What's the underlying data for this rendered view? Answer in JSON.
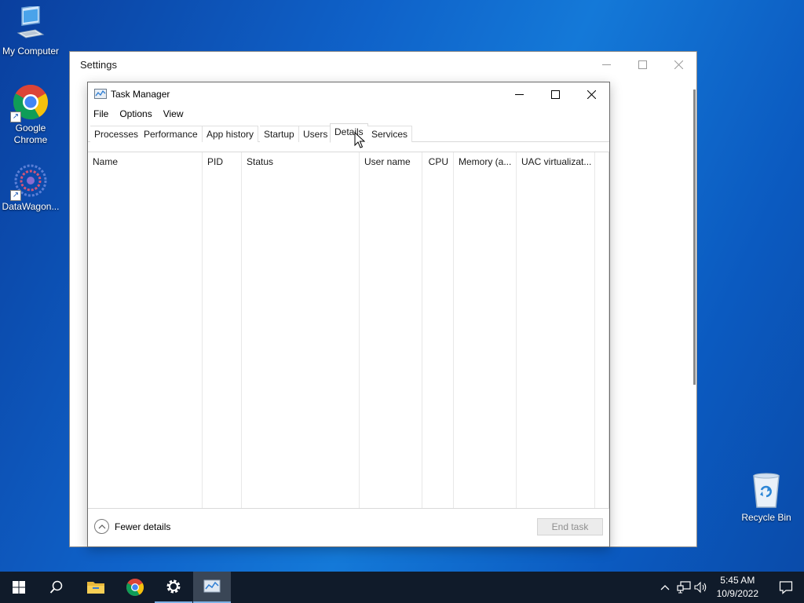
{
  "desktop": {
    "icons": [
      {
        "label": "My Computer",
        "icon": "computer-icon"
      },
      {
        "label": "Google Chrome",
        "icon": "chrome-icon"
      },
      {
        "label": "DataWagon...",
        "icon": "datawagon-icon"
      }
    ],
    "recycle_bin": {
      "label": "Recycle Bin",
      "icon": "recycle-bin-icon"
    }
  },
  "settings_window": {
    "title": "Settings"
  },
  "task_manager": {
    "title": "Task Manager",
    "menu": [
      "File",
      "Options",
      "View"
    ],
    "tabs": [
      "Processes",
      "Performance",
      "App history",
      "Startup",
      "Users",
      "Details",
      "Services"
    ],
    "active_tab": "Details",
    "columns": [
      "Name",
      "PID",
      "Status",
      "User name",
      "CPU",
      "Memory (a...",
      "UAC virtualizat..."
    ],
    "sorted_column": "Name",
    "rows": [],
    "fewer_details_label": "Fewer details",
    "end_task_label": "End task"
  },
  "taskbar": {
    "pinned": [
      "start-icon",
      "search-icon",
      "file-explorer-icon",
      "chrome-icon",
      "settings-icon",
      "task-manager-icon"
    ],
    "time": "5:45 AM",
    "date": "10/9/2022"
  },
  "colors": {
    "taskbar_bg": "#101b2a",
    "accent": "#7fb2e6",
    "desktop_bg": "#0f62c9"
  }
}
